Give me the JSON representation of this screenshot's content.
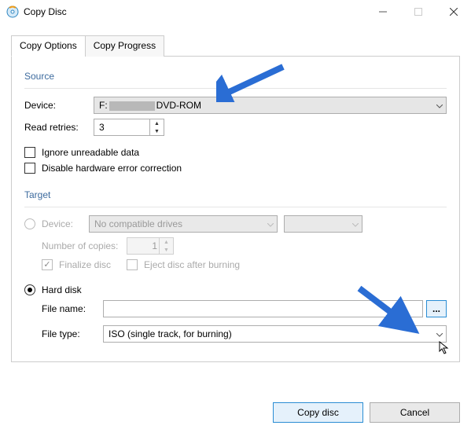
{
  "window": {
    "title": "Copy Disc"
  },
  "tabs": {
    "options": "Copy Options",
    "progress": "Copy Progress"
  },
  "source": {
    "group": "Source",
    "device_label": "Device:",
    "device_value_prefix": "F:",
    "device_value_suffix": "DVD-ROM",
    "retries_label": "Read retries:",
    "retries_value": "3",
    "ignore_label": "Ignore unreadable data",
    "disable_hw_label": "Disable hardware error correction"
  },
  "target": {
    "group": "Target",
    "device_label": "Device:",
    "device_value": "No compatible drives",
    "copies_label": "Number of copies:",
    "copies_value": "1",
    "finalize_label": "Finalize disc",
    "eject_label": "Eject disc after burning",
    "harddisk_label": "Hard disk",
    "filename_label": "File name:",
    "filename_value": "",
    "browse_label": "...",
    "filetype_label": "File type:",
    "filetype_value": "ISO (single track, for burning)"
  },
  "buttons": {
    "copy": "Copy disc",
    "cancel": "Cancel"
  }
}
